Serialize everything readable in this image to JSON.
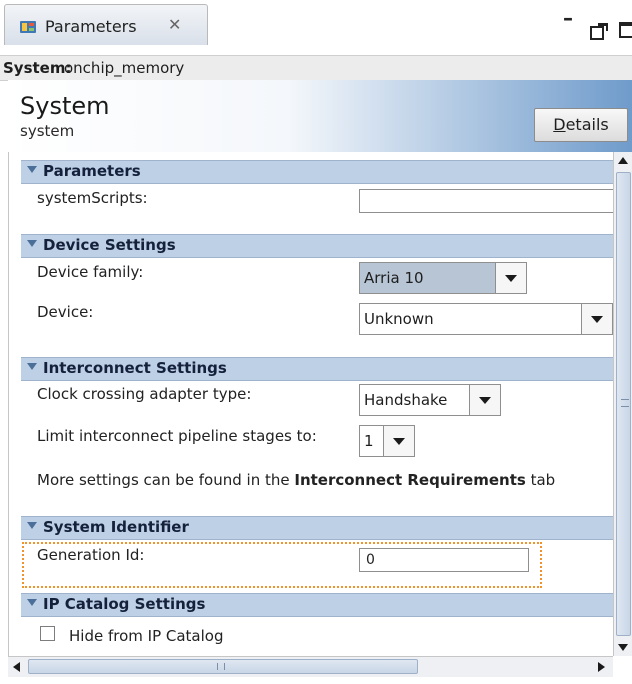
{
  "tab": {
    "title": "Parameters",
    "icon": "parameters-icon",
    "close_icon": "close-icon"
  },
  "window_controls": {
    "minimize": "minimize-icon",
    "maximize": "maximize-icon"
  },
  "system_row": {
    "label": "System:",
    "value": "onchip_memory"
  },
  "header": {
    "title": "System",
    "subtitle": "system",
    "details_button_prefix": "D",
    "details_button_rest": "etails"
  },
  "sections": {
    "parameters": {
      "title": "Parameters",
      "fields": {
        "system_scripts": {
          "label": "systemScripts:",
          "value": ""
        }
      }
    },
    "device_settings": {
      "title": "Device Settings",
      "device_family": {
        "label": "Device family:",
        "value": "Arria 10"
      },
      "device": {
        "label": "Device:",
        "value": "Unknown"
      }
    },
    "interconnect_settings": {
      "title": "Interconnect Settings",
      "clock_crossing": {
        "label": "Clock crossing adapter type:",
        "value": "Handshake"
      },
      "pipeline_stages": {
        "label": "Limit interconnect pipeline stages to:",
        "value": "1"
      },
      "note_prefix": "More settings can be found in the ",
      "note_bold": "Interconnect Requirements",
      "note_suffix": " tab"
    },
    "system_identifier": {
      "title": "System Identifier",
      "generation_id": {
        "label": "Generation Id:",
        "value": "0"
      }
    },
    "ip_catalog_settings": {
      "title": "IP Catalog Settings",
      "hide_checkbox": {
        "label": "Hide from IP Catalog",
        "checked": false
      }
    }
  },
  "colors": {
    "section_header_bg": "#bdd0e6",
    "header_gradient_end": "#6f9bcb",
    "focus_outline": "#f0932b"
  }
}
